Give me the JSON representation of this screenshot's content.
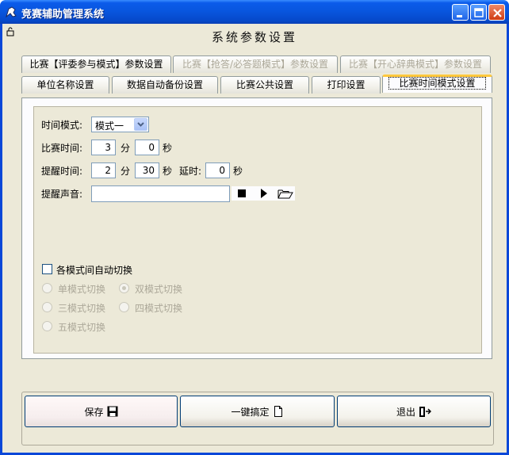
{
  "window": {
    "title": "竞赛辅助管理系统"
  },
  "page": {
    "heading": "系统参数设置"
  },
  "tabs_row1": [
    {
      "label": "比赛【评委参与模式】参数设置",
      "enabled": true
    },
    {
      "label": "比赛【抢答/必答题模式】参数设置",
      "enabled": false
    },
    {
      "label": "比赛【开心辞典模式】参数设置",
      "enabled": false
    }
  ],
  "tabs_row2": [
    {
      "label": "单位名称设置"
    },
    {
      "label": "数据自动备份设置"
    },
    {
      "label": "比赛公共设置"
    },
    {
      "label": "打印设置"
    },
    {
      "label": "比赛时间模式设置",
      "active": true
    }
  ],
  "form": {
    "mode_label": "时间模式:",
    "mode_value": "模式一",
    "race_time_label": "比赛时间:",
    "race_minutes": "3",
    "race_seconds": "0",
    "remind_label": "提醒时间:",
    "remind_minutes": "2",
    "remind_seconds": "30",
    "delay_label": "延时:",
    "delay_seconds": "0",
    "sound_label": "提醒声音:",
    "sound_path": "",
    "unit_minute": "分",
    "unit_second": "秒"
  },
  "auto_switch": {
    "label": "各模式间自动切换",
    "checked": false,
    "options": [
      "单模式切换",
      "双模式切换",
      "三模式切换",
      "四模式切换",
      "五模式切换"
    ],
    "selected": "双模式切换"
  },
  "buttons": {
    "save": "保存",
    "one_key": "一键搞定",
    "exit": "退出"
  },
  "colors": {
    "titlebar": "#0855dd",
    "client_bg": "#ece9d8",
    "tab_highlight": "#ffc83c"
  }
}
